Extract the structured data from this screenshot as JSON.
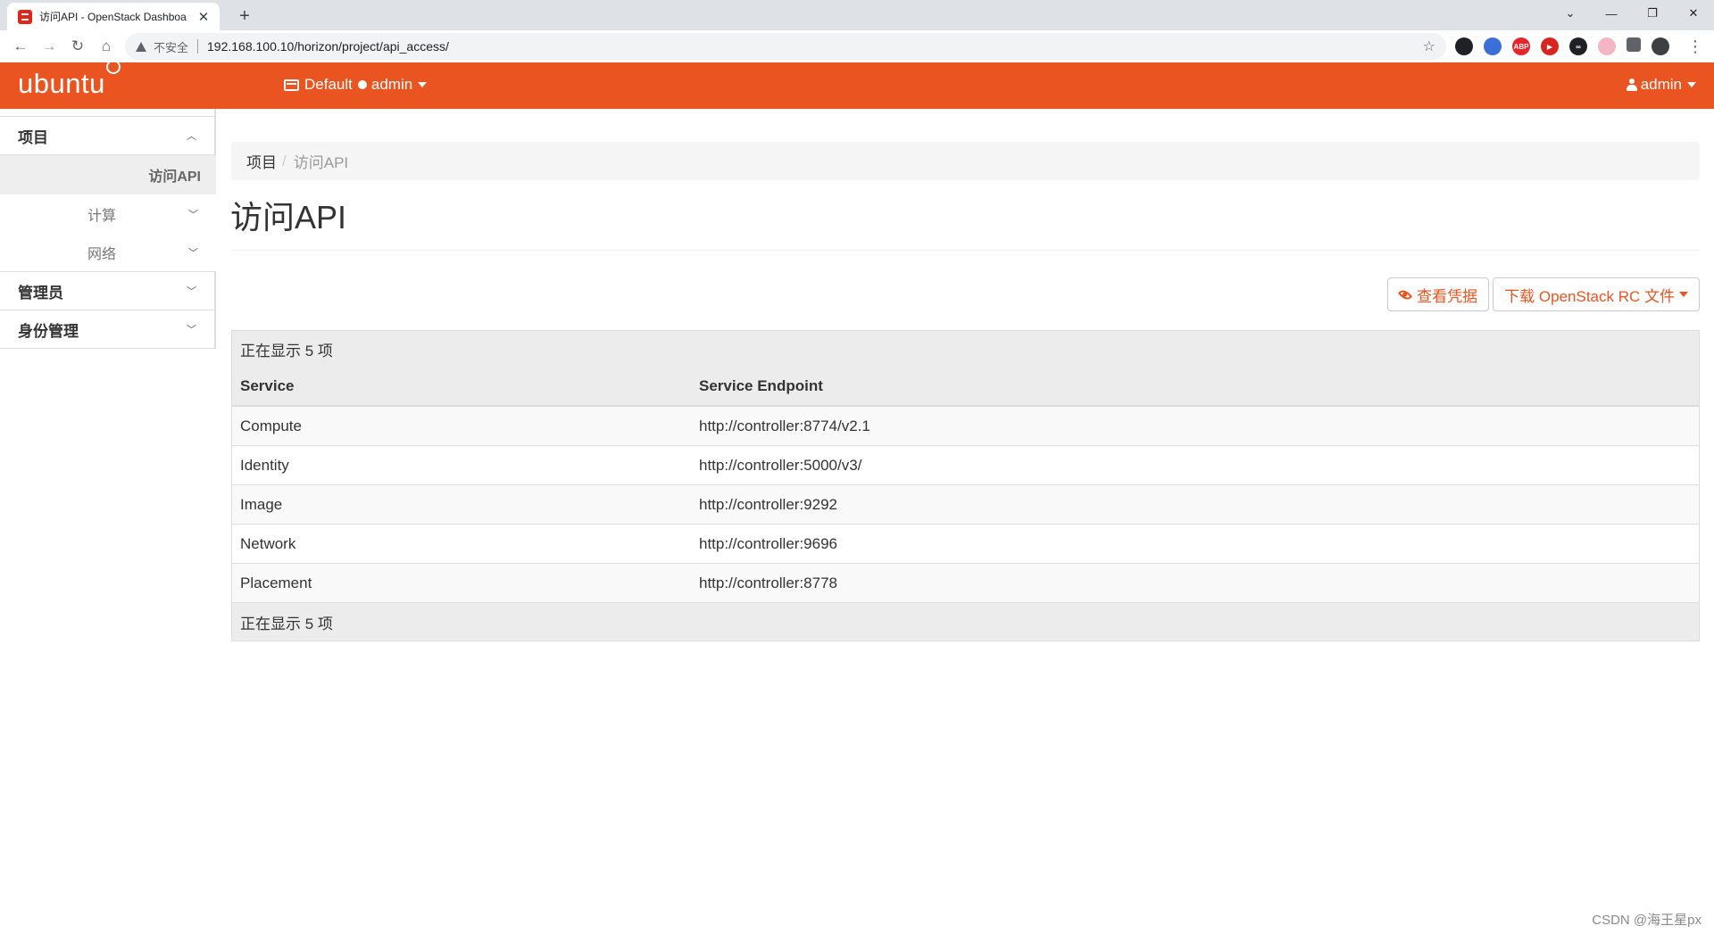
{
  "browser": {
    "tab_title": "访问API - OpenStack Dashboa",
    "tab_close": "✕",
    "new_tab": "+",
    "insecure_label": "不安全",
    "url": "192.168.100.10/horizon/project/api_access/",
    "extensions": [
      {
        "name": "ext-1-icon",
        "label": "",
        "color": "#202124"
      },
      {
        "name": "ext-2-icon",
        "label": "",
        "color": "#3b6fd8"
      },
      {
        "name": "abp-icon",
        "label": "ABP",
        "color": "#e8232a"
      },
      {
        "name": "ext-4-icon",
        "label": "▶",
        "color": "#d9241f"
      },
      {
        "name": "ext-5-icon",
        "label": "∞",
        "color": "#202124"
      },
      {
        "name": "ext-6-icon",
        "label": "",
        "color": "#f4b6c4"
      },
      {
        "name": "puzzle-icon",
        "label": "",
        "color": "#5f6368"
      },
      {
        "name": "profile-avatar",
        "label": "",
        "color": "#3c4043"
      }
    ]
  },
  "header": {
    "brand": "ubuntu",
    "domain": "Default",
    "project": "admin",
    "user": "admin",
    "accent_color": "#e95420"
  },
  "sidebar": {
    "section_project": "项目",
    "active_item": "访问API",
    "sub_compute": "计算",
    "sub_network": "网络",
    "section_admin": "管理员",
    "section_identity": "身份管理"
  },
  "breadcrumb": {
    "parent": "项目",
    "separator": "/",
    "current": "访问API"
  },
  "page": {
    "title": "访问API"
  },
  "actions": {
    "view_credentials": "查看凭据",
    "download_rc": "下载 OpenStack RC 文件"
  },
  "table": {
    "count_top": "正在显示 5 项",
    "count_bottom": "正在显示 5 项",
    "columns": [
      "Service",
      "Service Endpoint"
    ],
    "rows": [
      {
        "service": "Compute",
        "endpoint": "http://controller:8774/v2.1"
      },
      {
        "service": "Identity",
        "endpoint": "http://controller:5000/v3/"
      },
      {
        "service": "Image",
        "endpoint": "http://controller:9292"
      },
      {
        "service": "Network",
        "endpoint": "http://controller:9696"
      },
      {
        "service": "Placement",
        "endpoint": "http://controller:8778"
      }
    ]
  },
  "watermark": "CSDN @海王星px"
}
